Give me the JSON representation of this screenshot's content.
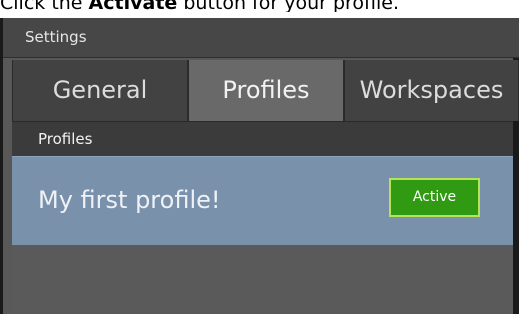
{
  "instruction": {
    "prefix": "Click the ",
    "bold": "Activate",
    "suffix": " button for your profile."
  },
  "window": {
    "title": "Settings"
  },
  "tabs": [
    {
      "label": "General"
    },
    {
      "label": "Profiles"
    },
    {
      "label": "Workspaces"
    }
  ],
  "section": {
    "title": "Profiles"
  },
  "profile": {
    "name": "My first profile!",
    "button_label": "Active"
  },
  "colors": {
    "profile_row": "#7a91ac",
    "active_button": "#2f9a12",
    "active_border": "#b4e35a"
  }
}
